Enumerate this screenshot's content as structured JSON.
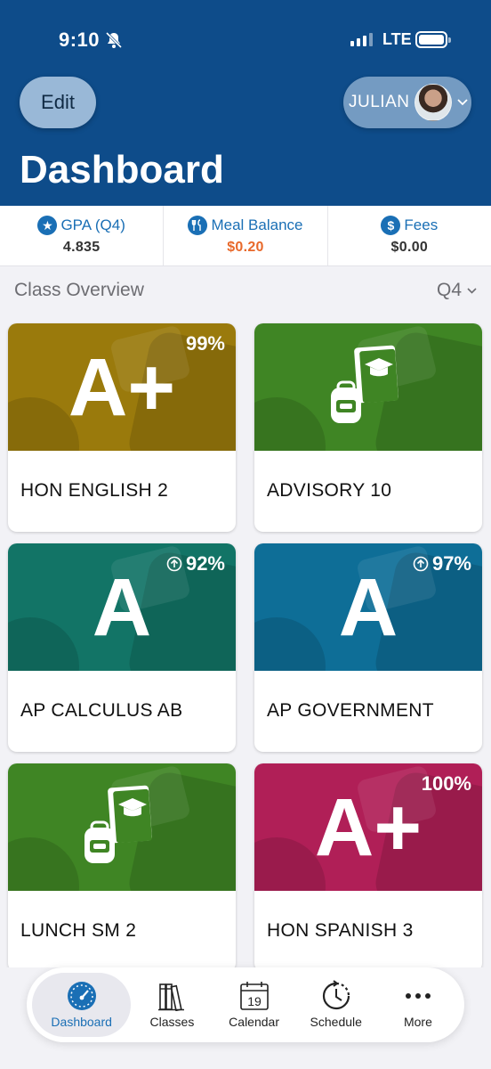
{
  "status_bar": {
    "time": "9:10",
    "network": "LTE"
  },
  "header": {
    "edit_label": "Edit",
    "user_name": "JULIAN",
    "title": "Dashboard"
  },
  "stats": [
    {
      "label": "GPA (Q4)",
      "value": "4.835",
      "icon": "star-circle-icon"
    },
    {
      "label": "Meal Balance",
      "value": "$0.20",
      "icon": "utensils-circle-icon"
    },
    {
      "label": "Fees",
      "value": "$0.00",
      "icon": "dollar-circle-icon"
    }
  ],
  "overview": {
    "label": "Class Overview",
    "quarter": "Q4"
  },
  "classes": [
    {
      "name": "HON ENGLISH 2",
      "grade": "A+",
      "percent": "99%",
      "trend": "",
      "color": "#9a7a0c"
    },
    {
      "name": "ADVISORY 10",
      "grade": "",
      "percent": "",
      "trend": "",
      "color": "#3f8524",
      "icon": "backpack-book-icon"
    },
    {
      "name": "AP CALCULUS AB",
      "grade": "A",
      "percent": "92%",
      "trend": "up",
      "color": "#127466"
    },
    {
      "name": "AP GOVERNMENT",
      "grade": "A",
      "percent": "97%",
      "trend": "up",
      "color": "#0e6e97"
    },
    {
      "name": "LUNCH SM 2",
      "grade": "",
      "percent": "",
      "trend": "",
      "color": "#3f8524",
      "icon": "backpack-book-icon"
    },
    {
      "name": "HON SPANISH 3",
      "grade": "A+",
      "percent": "100%",
      "trend": "",
      "color": "#b01f57"
    }
  ],
  "tabs": [
    {
      "label": "Dashboard",
      "icon": "speedometer-icon",
      "active": true
    },
    {
      "label": "Classes",
      "icon": "books-icon",
      "active": false
    },
    {
      "label": "Calendar",
      "icon": "calendar-icon",
      "calendar_day": "19",
      "active": false
    },
    {
      "label": "Schedule",
      "icon": "clock-history-icon",
      "active": false
    },
    {
      "label": "More",
      "icon": "more-dots-icon",
      "active": false
    }
  ]
}
